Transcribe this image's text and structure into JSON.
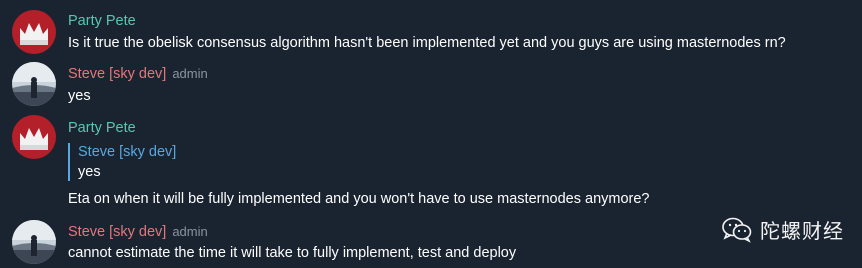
{
  "messages": [
    {
      "author": "Party Pete",
      "role": "",
      "text": "Is it true the obelisk consensus algorithm hasn't been implemented yet and you guys are using masternodes rn?"
    },
    {
      "author": "Steve [sky dev]",
      "role": "admin",
      "text": "yes"
    },
    {
      "author": "Party Pete",
      "role": "",
      "reply_to_author": "Steve [sky dev]",
      "reply_to_text": "yes",
      "text": "Eta on when it will be fully implemented and you won't have to use masternodes anymore?"
    },
    {
      "author": "Steve [sky dev]",
      "role": "admin",
      "text": "cannot estimate the time it will take to fully implement, test and deploy"
    }
  ],
  "watermark": {
    "text": "陀螺财经",
    "icon": "wechat-icon"
  },
  "colors": {
    "background": "#1a2330",
    "pete_name": "#58c7ad",
    "steve_name": "#e2787a",
    "reply_accent": "#5aa8e0",
    "role": "#8a93a0"
  }
}
